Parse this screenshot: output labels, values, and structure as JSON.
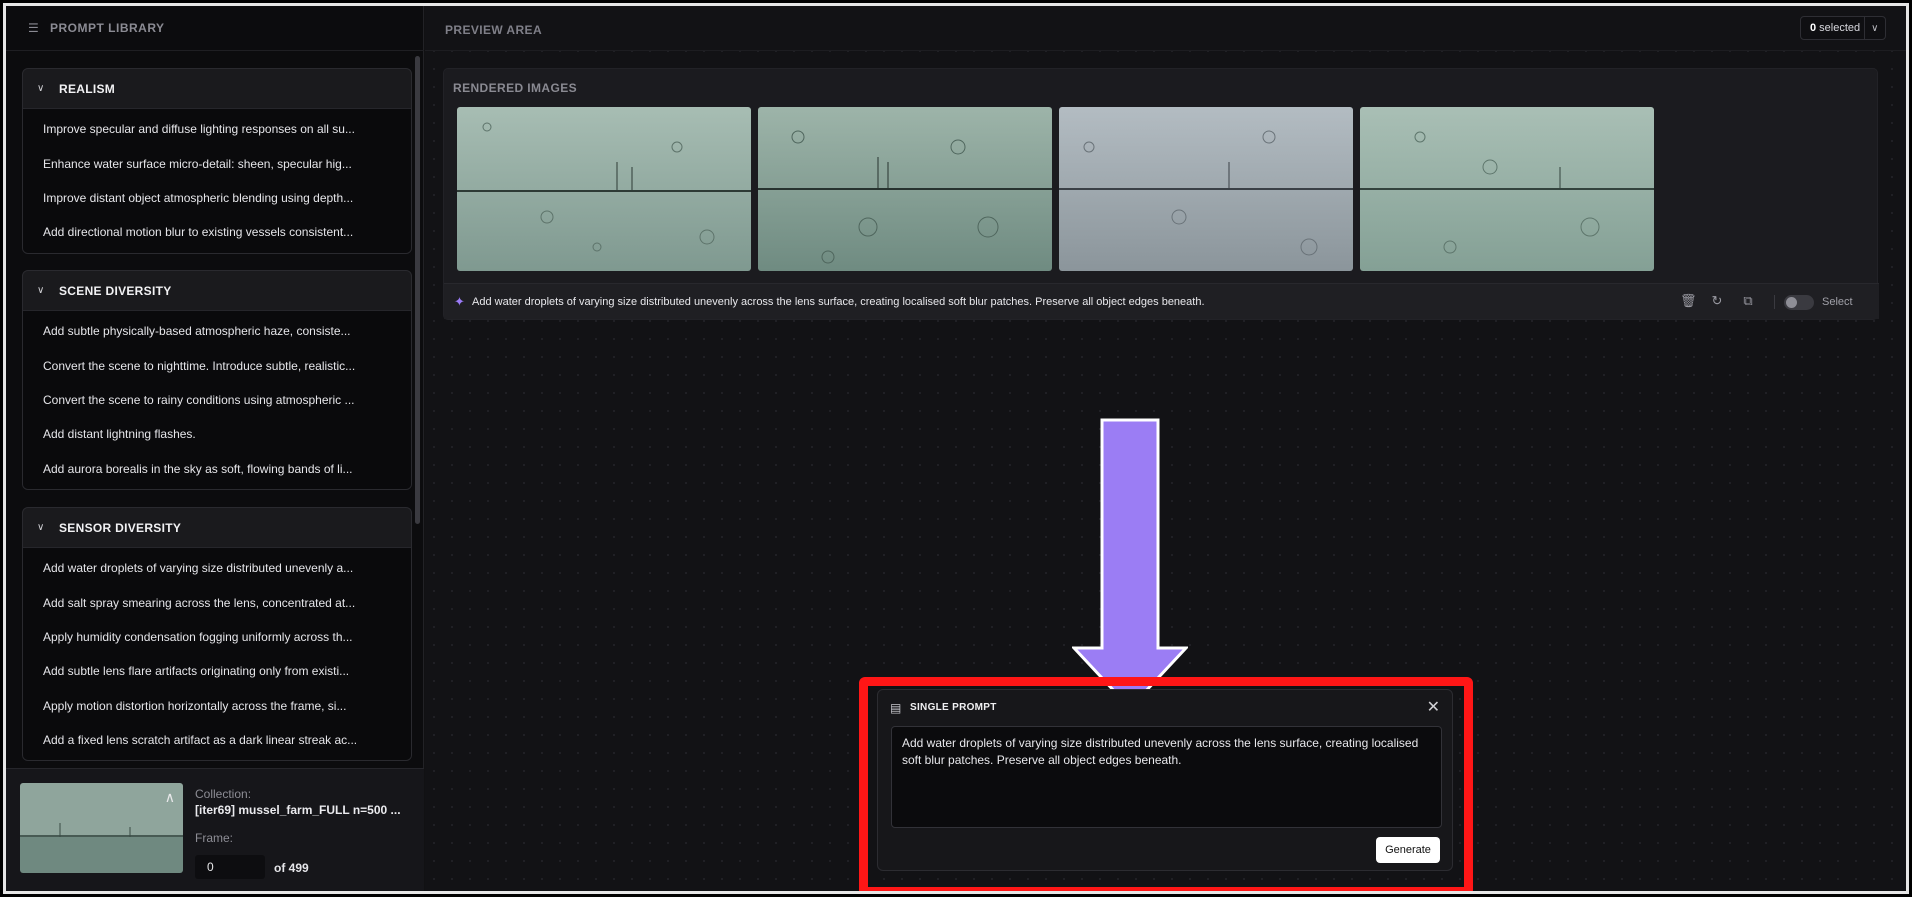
{
  "sidebar": {
    "title": "PROMPT LIBRARY",
    "groups": [
      {
        "title": "REALISM",
        "items": [
          "Improve specular and diffuse lighting responses on all su...",
          "Enhance water surface micro-detail: sheen, specular hig...",
          "Improve distant object atmospheric blending using depth...",
          "Add directional motion blur to existing vessels consistent..."
        ]
      },
      {
        "title": "SCENE DIVERSITY",
        "items": [
          "Add subtle physically-based atmospheric haze, consiste...",
          "Convert the scene to nighttime. Introduce subtle, realistic...",
          "Convert the scene to rainy conditions using atmospheric ...",
          "Add distant lightning flashes.",
          "Add aurora borealis in the sky as soft, flowing bands of li..."
        ]
      },
      {
        "title": "SENSOR DIVERSITY",
        "items": [
          "Add water droplets of varying size distributed unevenly a...",
          "Add salt spray smearing across the lens, concentrated at...",
          "Apply humidity condensation fogging uniformly across th...",
          "Add subtle lens flare artifacts originating only from existi...",
          "Apply motion distortion horizontally across the frame, si...",
          "Add a fixed lens scratch artifact as a dark linear streak ac..."
        ]
      }
    ],
    "footer": {
      "collection_label": "Collection:",
      "collection_value": "[iter69] mussel_farm_FULL n=500 ...",
      "frame_label": "Frame:",
      "frame_value": "0",
      "frame_total": "of 499"
    }
  },
  "main": {
    "title": "PREVIEW AREA",
    "selected_count": "0",
    "selected_suffix": " selected",
    "rendered": {
      "title": "RENDERED IMAGES",
      "prompt": "Add water droplets of varying size distributed unevenly across the lens surface, creating localised soft blur patches. Preserve all object edges beneath.",
      "select_label": "Select"
    }
  },
  "dialog": {
    "title": "SINGLE PROMPT",
    "text": "Add water droplets of varying size distributed unevenly across the lens surface, creating localised soft blur patches. Preserve all object edges beneath.",
    "generate_label": "Generate"
  },
  "colors": {
    "accent_purple": "#9b7bf7",
    "arrow_fill": "#9b7df4",
    "highlight_red": "#ff1616"
  },
  "icons": [
    "library-icon",
    "chevron-down-icon",
    "chevron-up-icon",
    "wand-icon",
    "trash-icon",
    "refresh-icon",
    "copy-icon",
    "prompt-icon",
    "close-icon"
  ]
}
